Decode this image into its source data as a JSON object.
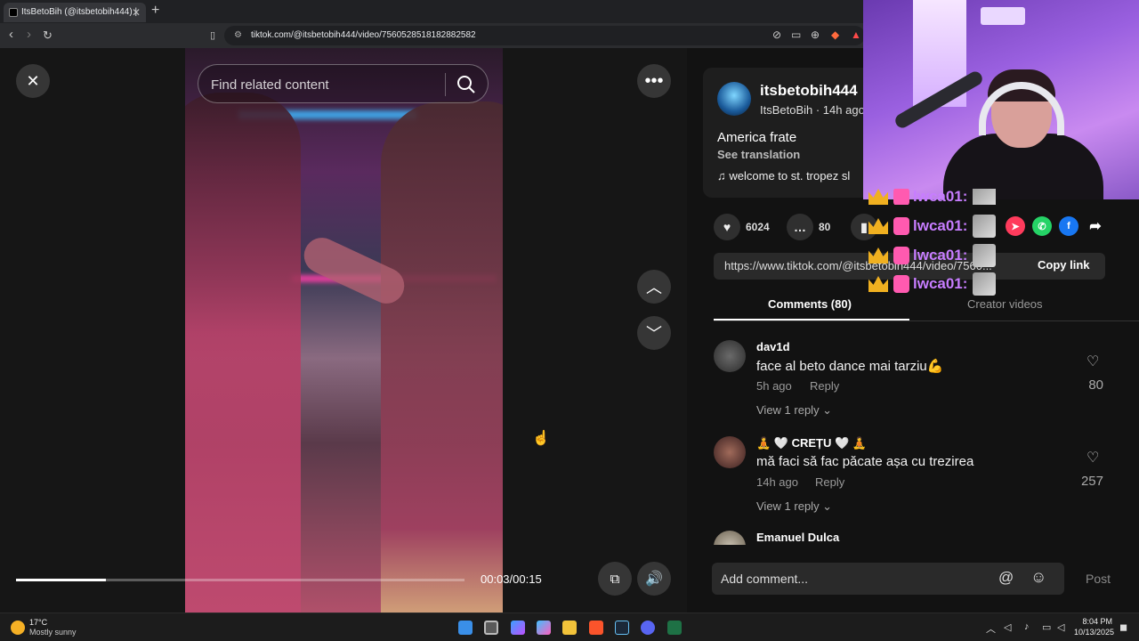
{
  "browser": {
    "tab_title": "ItsBetoBih (@itsbetobih444) | ",
    "tab_close": "✕",
    "new_tab": "+",
    "url": "tiktok.com/@itsbetobih444/video/7560528518182882582"
  },
  "player": {
    "search_placeholder": "Find related content",
    "time": "00:03/00:15",
    "progress": 0.2
  },
  "post": {
    "username": "itsbetobih444",
    "display_meta": "ItsBetoBih · 14h ago",
    "caption": "America frate",
    "see_translation": "See translation",
    "music": "welcome to st. tropez sl",
    "likes": "6024",
    "comments": "80",
    "link": "https://www.tiktok.com/@itsbetobih444/video/7560...",
    "copy_link": "Copy link"
  },
  "tabs": {
    "comments": "Comments (80)",
    "creator_videos": "Creator videos"
  },
  "comments": [
    {
      "name": "dav1d",
      "text": "face al beto dance mai tarziu💪",
      "time": "5h ago",
      "reply": "Reply",
      "view": "View 1 reply ⌄",
      "likes": "80"
    },
    {
      "name": "🧘 🤍 CREȚU 🤍 🧘",
      "text": "mă faci să fac păcate așa cu trezirea",
      "time": "14h ago",
      "reply": "Reply",
      "view": "View 1 reply ⌄",
      "likes": "257"
    },
    {
      "name": "Emanuel Dulca"
    }
  ],
  "composer": {
    "placeholder": "Add comment...",
    "post": "Post"
  },
  "chat": {
    "lines": [
      "lwca01:",
      "lwca01:",
      "lwca01:",
      "lwca01:"
    ]
  },
  "taskbar": {
    "weather_temp": "17°C",
    "weather_desc": "Mostly sunny",
    "time": "8:04 PM",
    "date": "10/13/2025"
  }
}
